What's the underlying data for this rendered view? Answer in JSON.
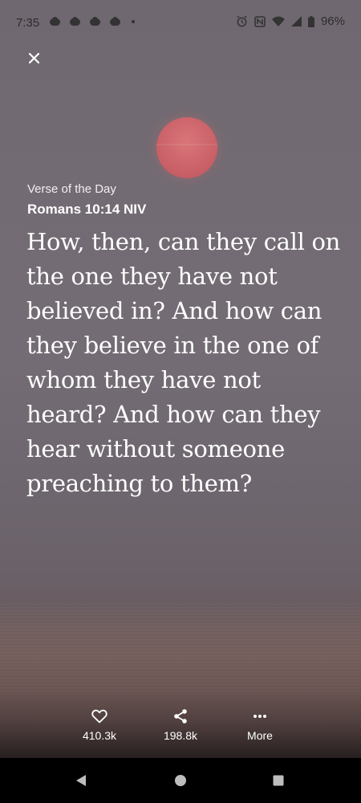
{
  "status_bar": {
    "time": "7:35",
    "battery": "96%"
  },
  "verse": {
    "label": "Verse of the Day",
    "reference": "Romans 10:14 NIV",
    "text": "How, then, can they call on the one they have not believed in? And how can they believe in the one of whom they have not heard? And how can they hear without someone preaching to them?"
  },
  "actions": {
    "like_count": "410.3k",
    "share_count": "198.8k",
    "more_label": "More"
  },
  "colors": {
    "sun": "#c85e66",
    "text": "#ffffff"
  }
}
